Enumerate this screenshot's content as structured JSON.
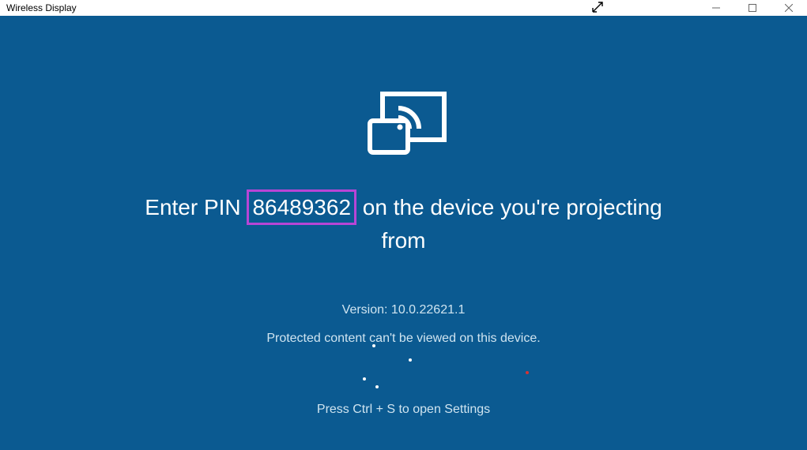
{
  "titlebar": {
    "title": "Wireless Display"
  },
  "main": {
    "pin_prefix": "Enter PIN ",
    "pin_value": "86489362",
    "pin_suffix": " on the device you're projecting from",
    "version_label": "Version: 10.0.22621.1",
    "protected_text": "Protected content can't be viewed on this device.",
    "settings_hint": "Press Ctrl + S to open Settings"
  }
}
